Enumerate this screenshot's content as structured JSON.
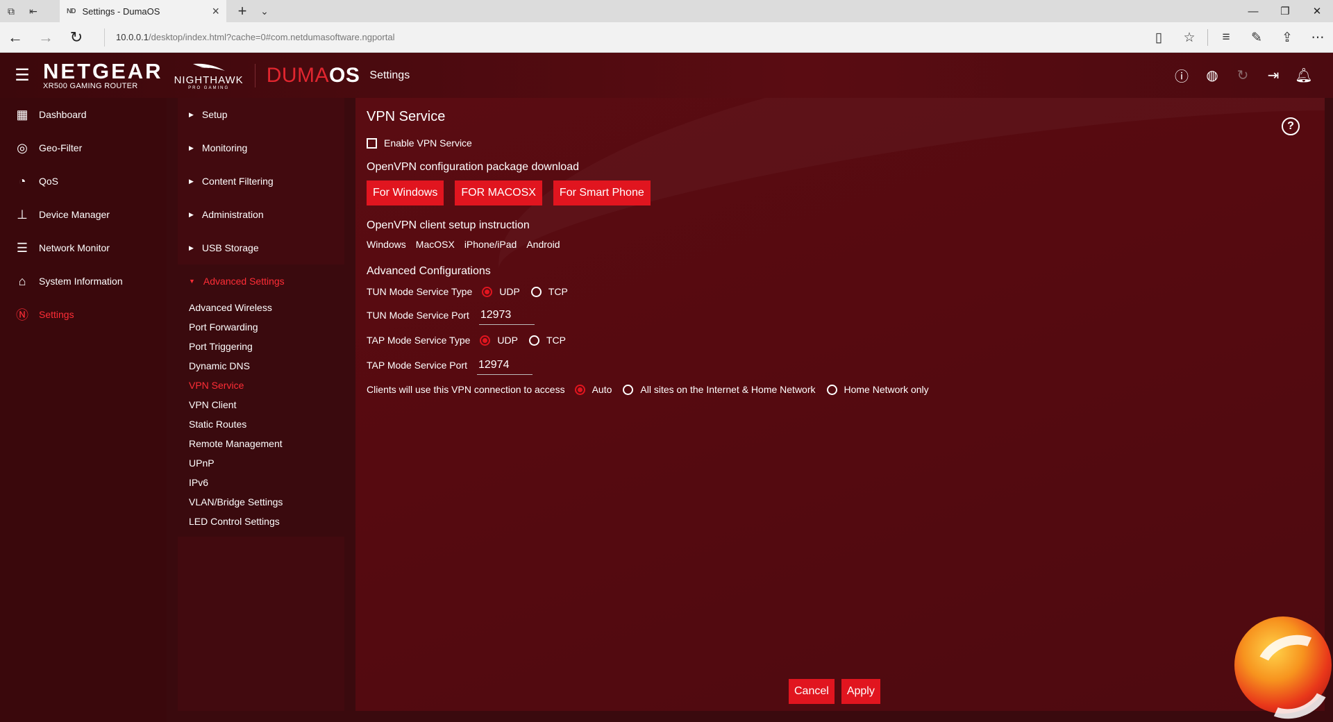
{
  "browser": {
    "tab_favicon": "ND",
    "tab_title": "Settings - DumaOS",
    "url_host": "10.0.0.1",
    "url_rest": "/desktop/index.html?cache=0#com.netdumasoftware.ngportal"
  },
  "header": {
    "brand": "NETGEAR",
    "model": "XR500 GAMING ROUTER",
    "nighthawk": "NIGHTHAWK",
    "pro_gaming": "PRO GAMING",
    "duma": "DUMA",
    "os": "OS",
    "page": "Settings"
  },
  "leftnav": {
    "items": [
      {
        "label": "Dashboard",
        "icon": "dashboard-icon"
      },
      {
        "label": "Geo-Filter",
        "icon": "geo-filter-icon"
      },
      {
        "label": "QoS",
        "icon": "qos-icon"
      },
      {
        "label": "Device Manager",
        "icon": "device-manager-icon"
      },
      {
        "label": "Network Monitor",
        "icon": "network-monitor-icon"
      },
      {
        "label": "System Information",
        "icon": "system-information-icon"
      },
      {
        "label": "Settings",
        "icon": "netgear-settings-icon"
      }
    ]
  },
  "subnav": {
    "items": [
      "Setup",
      "Monitoring",
      "Content Filtering",
      "Administration",
      "USB Storage",
      "Advanced Settings"
    ],
    "advanced": [
      "Advanced Wireless",
      "Port Forwarding",
      "Port Triggering",
      "Dynamic DNS",
      "VPN Service",
      "VPN Client",
      "Static Routes",
      "Remote Management",
      "UPnP",
      "IPv6",
      "VLAN/Bridge Settings",
      "LED Control Settings"
    ]
  },
  "main": {
    "title": "VPN Service",
    "enable_label": "Enable VPN Service",
    "download_heading": "OpenVPN configuration package download",
    "btn_windows": "For Windows",
    "btn_macosx": "FOR MACOSX",
    "btn_smartphone": "For Smart Phone",
    "instr_heading": "OpenVPN client setup instruction",
    "instr_links": [
      "Windows",
      "MacOSX",
      "iPhone/iPad",
      "Android"
    ],
    "adv_heading": "Advanced Configurations",
    "tun_type_label": "TUN Mode Service Type",
    "tun_port_label": "TUN Mode Service Port",
    "tun_port": "12973",
    "tap_type_label": "TAP Mode Service Type",
    "tap_port_label": "TAP Mode Service Port",
    "tap_port": "12974",
    "udp": "UDP",
    "tcp": "TCP",
    "access_label": "Clients will use this VPN connection to access",
    "access_auto": "Auto",
    "access_all": "All sites on the Internet & Home Network",
    "access_home": "Home Network only",
    "cancel": "Cancel",
    "apply": "Apply"
  },
  "colors": {
    "accent": "#e1151f",
    "active_text": "#ff2d36",
    "background": "#560a10"
  }
}
